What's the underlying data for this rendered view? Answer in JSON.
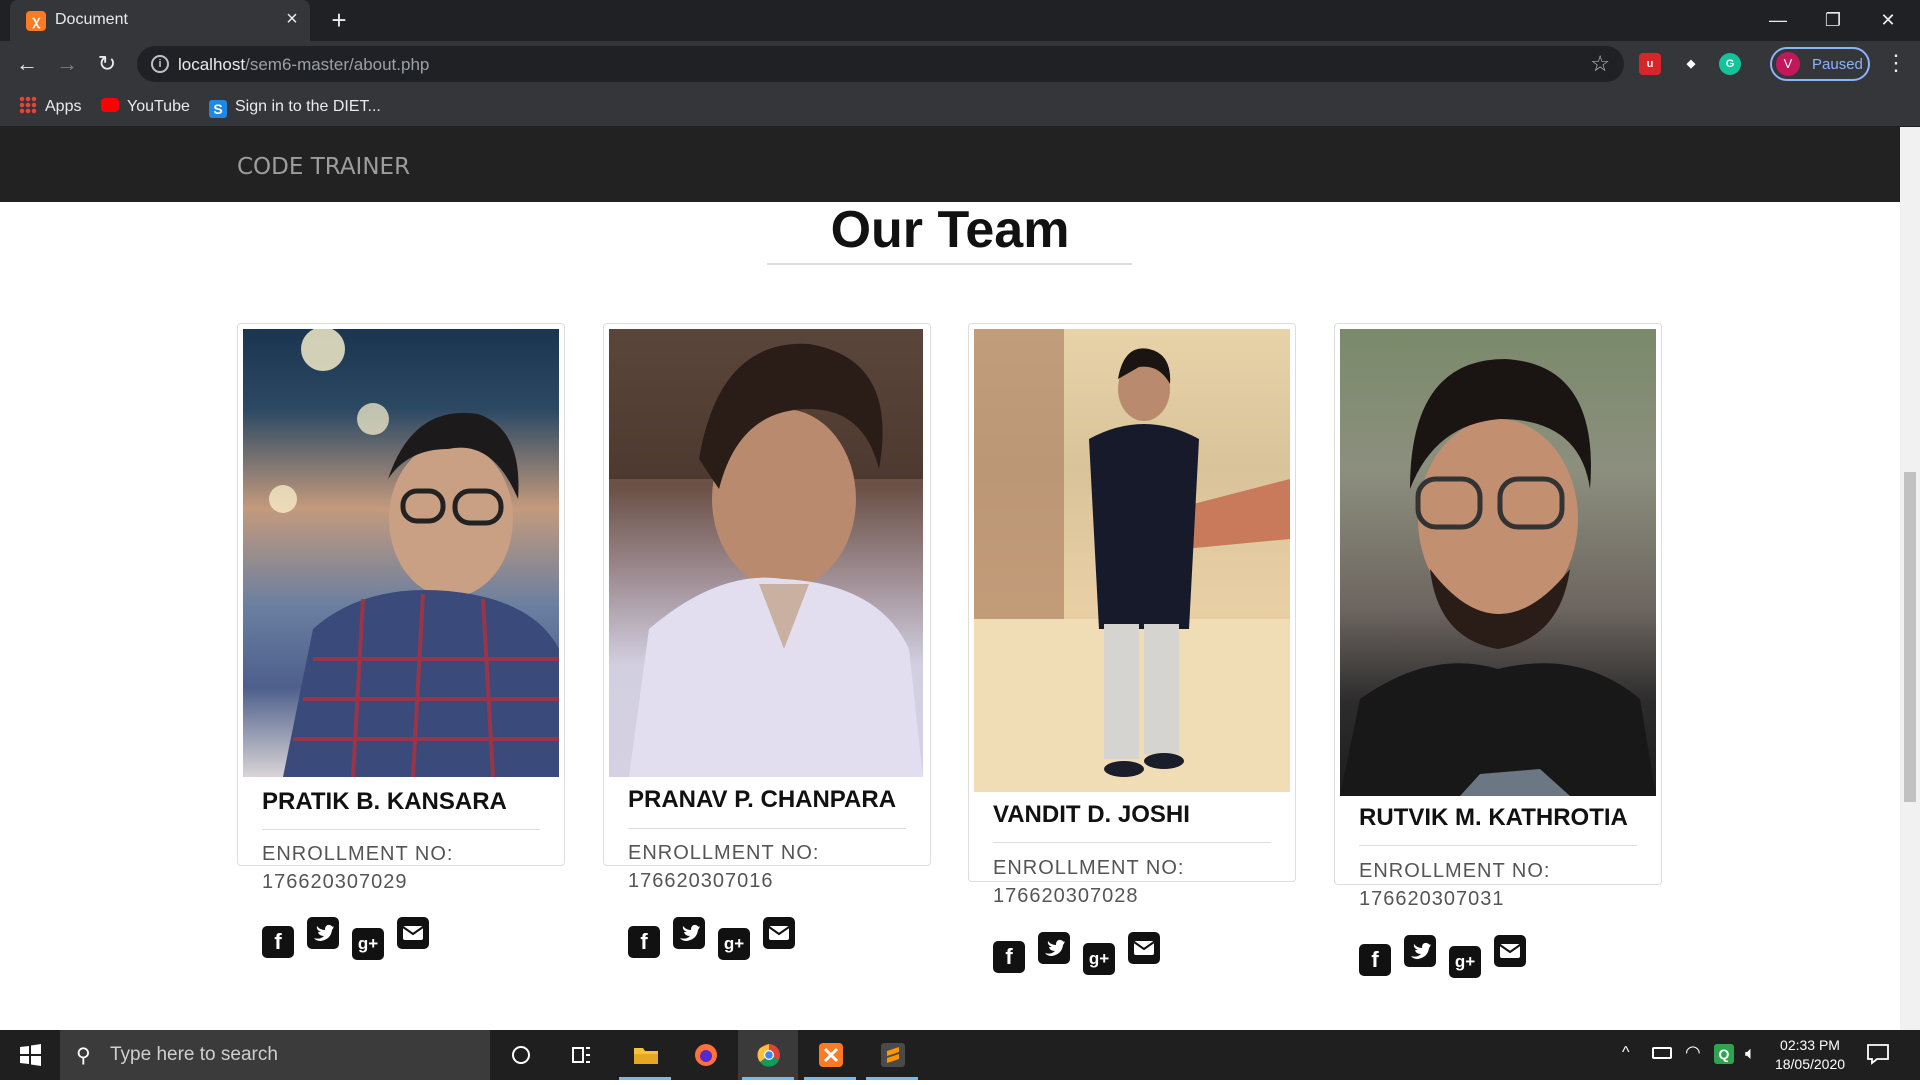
{
  "browser": {
    "tab_title": "Document",
    "url_host": "localhost",
    "url_path": "/sem6-master/about.php",
    "profile_initial": "V",
    "profile_status": "Paused",
    "bookmarks": [
      {
        "label": "Apps"
      },
      {
        "label": "YouTube"
      },
      {
        "label": "Sign in to the DIET..."
      }
    ]
  },
  "page": {
    "brand": "CODE TRAINER",
    "heading": "Our Team",
    "enroll_label": "ENROLLMENT NO:",
    "members": [
      {
        "name": "PRATIK B. KANSARA",
        "enrollment": "176620307029"
      },
      {
        "name": "PRANAV P. CHANPARA",
        "enrollment": "176620307016"
      },
      {
        "name": "VANDIT D. JOSHI",
        "enrollment": "176620307028"
      },
      {
        "name": "RUTVIK M. KATHROTIA",
        "enrollment": "176620307031"
      }
    ],
    "social_icons": [
      "facebook-icon",
      "twitter-icon",
      "google-plus-icon",
      "envelope-icon"
    ]
  },
  "taskbar": {
    "search_placeholder": "Type here to search",
    "time": "02:33 PM",
    "date": "18/05/2020"
  },
  "colors": {
    "navbar_bg": "#222222",
    "brand_text": "#9d9d9d",
    "chrome_dark": "#202124",
    "chrome_toolbar": "#35363a"
  }
}
